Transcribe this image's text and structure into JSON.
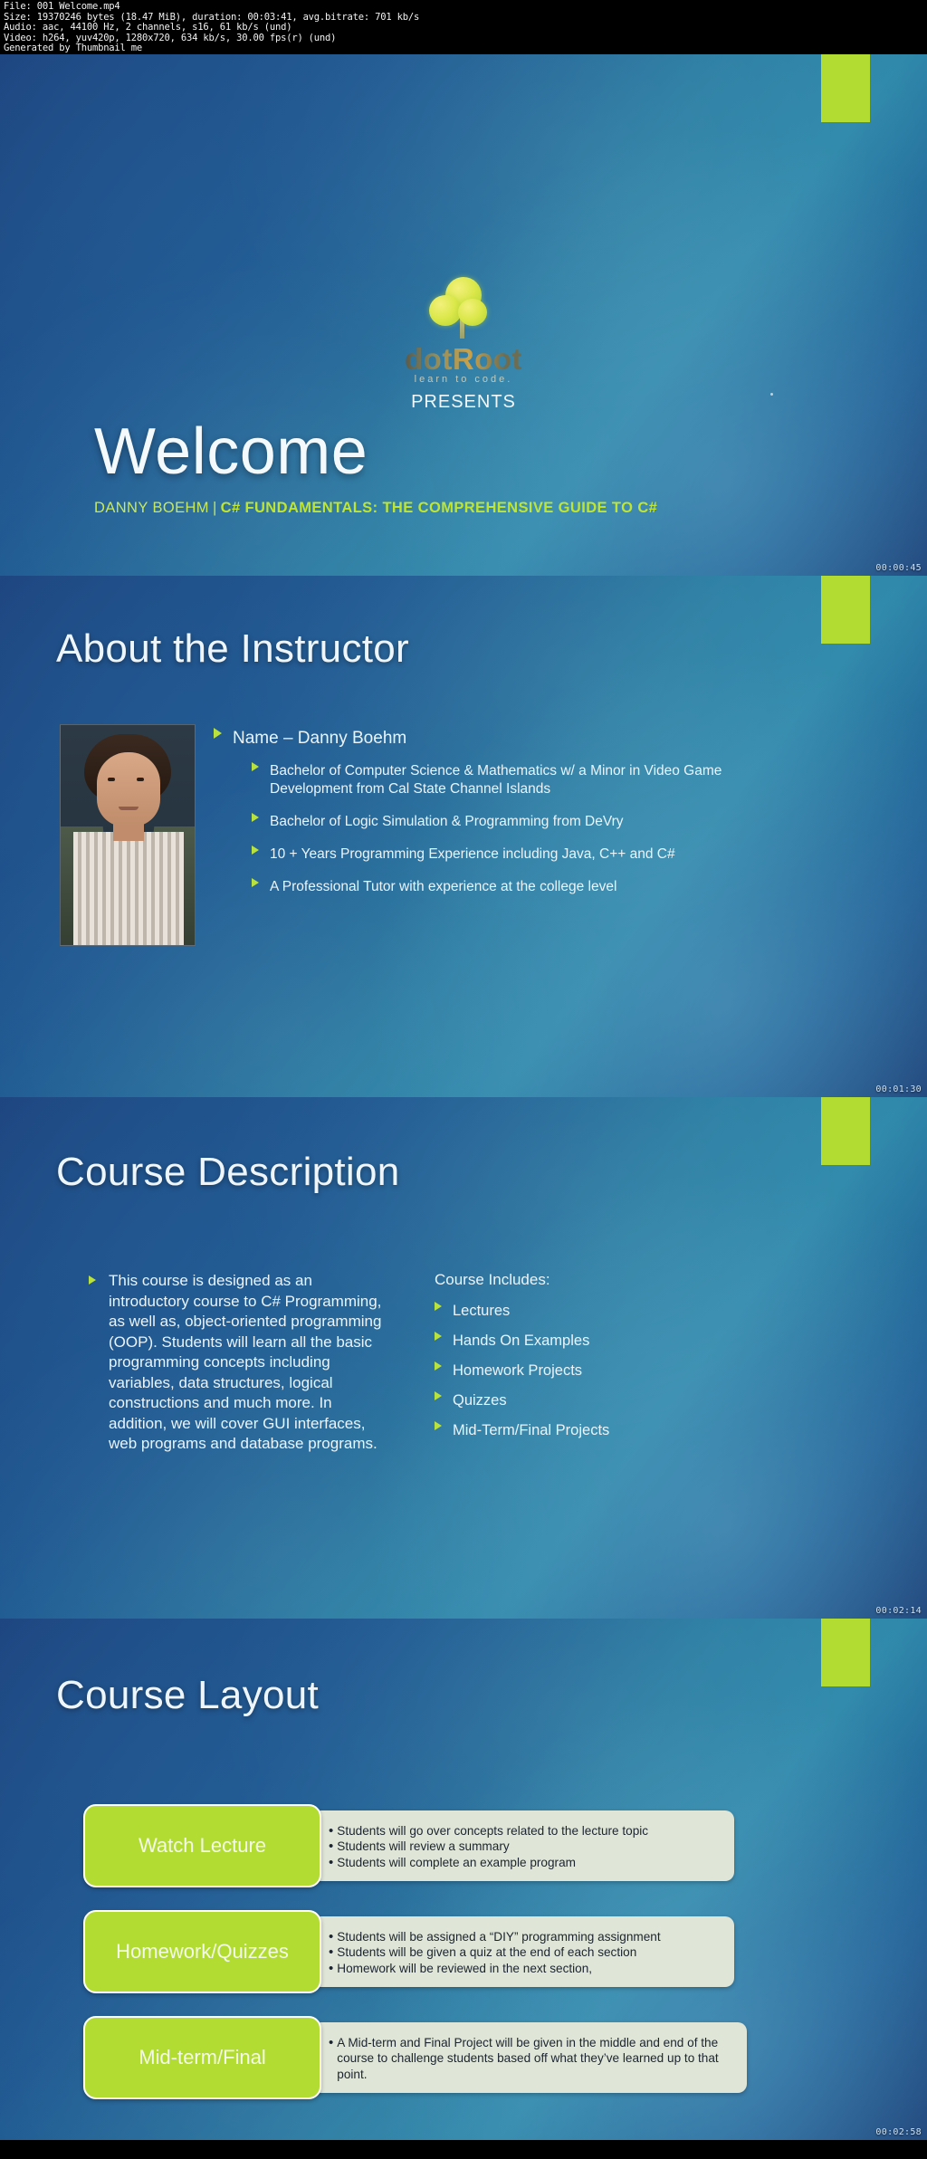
{
  "info_header": {
    "lines": [
      "File: 001 Welcome.mp4",
      "Size: 19370246 bytes (18.47 MiB), duration: 00:03:41, avg.bitrate: 701 kb/s",
      "Audio: aac, 44100 Hz, 2 channels, s16, 61 kb/s (und)",
      "Video: h264, yuv420p, 1280x720, 634 kb/s, 30.00 fps(r) (und)",
      "Generated by Thumbnail me"
    ]
  },
  "slides": [
    {
      "timestamp": "00:00:45",
      "logo": {
        "word": "dotRoot",
        "tagline": "learn to code.",
        "presents": "PRESENTS"
      },
      "title": "Welcome",
      "subtitle_author": "DANNY BOEHM",
      "subtitle_separator": "|",
      "subtitle_course": "C# FUNDAMENTALS: THE COMPREHENSIVE GUIDE TO C#"
    },
    {
      "timestamp": "00:01:30",
      "title": "About the Instructor",
      "lead_bullet": "Name – Danny Boehm",
      "sub_bullets": [
        "Bachelor of Computer Science & Mathematics w/ a Minor in Video Game Development from Cal State Channel Islands",
        "Bachelor of Logic Simulation & Programming from DeVry",
        "10 + Years Programming Experience including Java, C++ and C#",
        "A Professional Tutor with experience at the college level"
      ]
    },
    {
      "timestamp": "00:02:14",
      "title": "Course Description",
      "paragraph": "This course is designed as an introductory course to C# Programming, as well as, object-oriented programming (OOP). Students will learn all the basic programming concepts including variables, data structures, logical constructions and much more. In addition, we will cover GUI interfaces, web programs and database programs.",
      "includes_heading": "Course Includes:",
      "includes": [
        "Lectures",
        "Hands On Examples",
        "Homework Projects",
        "Quizzes",
        "Mid-Term/Final Projects"
      ]
    },
    {
      "timestamp": "00:02:58",
      "title": "Course Layout",
      "rows": [
        {
          "label": "Watch Lecture",
          "details": [
            "Students will go over concepts related to the lecture topic",
            "Students will review a summary",
            "Students will complete an example program"
          ]
        },
        {
          "label": "Homework/Quizzes",
          "details": [
            "Students will be assigned a “DIY” programming assignment",
            "Students will be given a quiz at the end of each section",
            "Homework will be reviewed in the next section,"
          ]
        },
        {
          "label": "Mid-term/Final",
          "details": [
            "A Mid-term and Final Project will be given in the middle and end of the course to challenge students based off what they’ve learned up to that point."
          ]
        }
      ]
    }
  ],
  "colors": {
    "accent_green": "#b3dc33",
    "subtitle_green": "#bfe532",
    "slide_blue": "#2b7fa4",
    "detail_box": "#dfe6d8"
  }
}
